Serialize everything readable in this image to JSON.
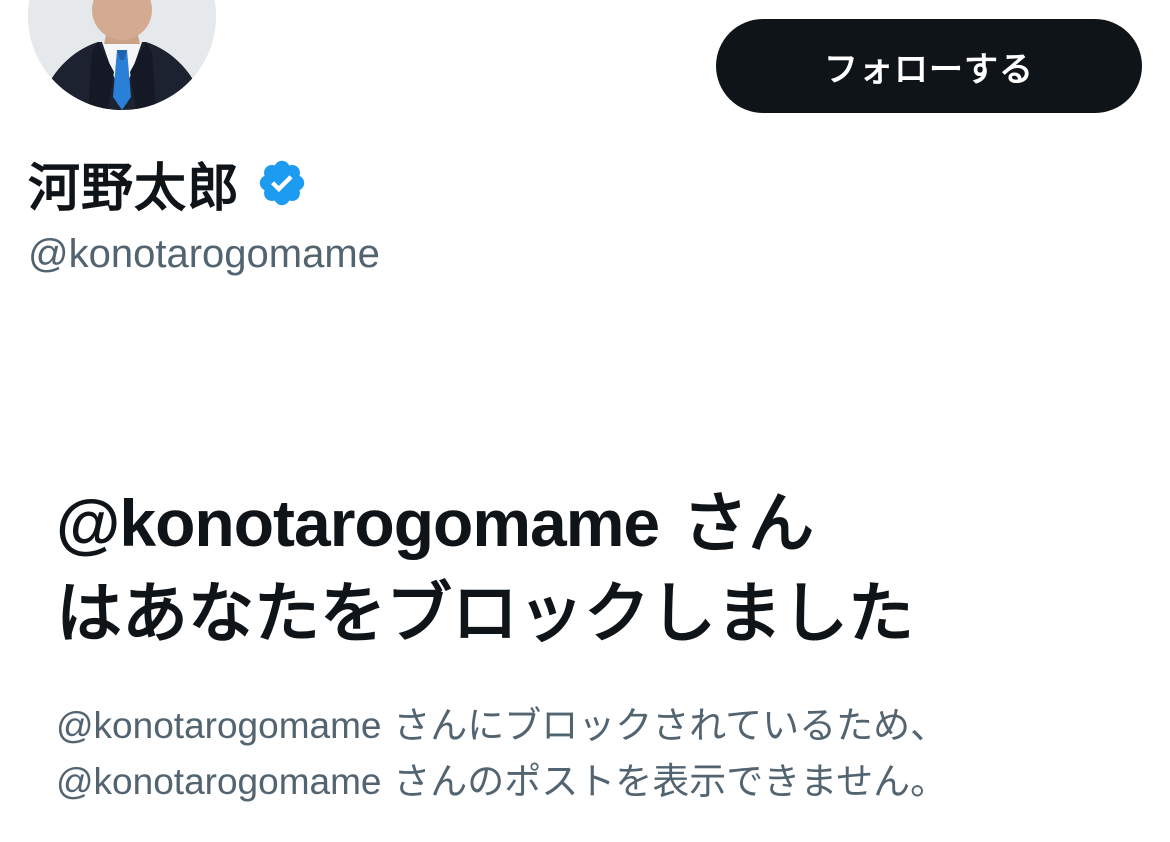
{
  "profile": {
    "display_name": "河野太郎",
    "handle": "@konotarogomame",
    "verified": true,
    "verified_color": "#1d9bf0"
  },
  "follow_button": {
    "label": "フォローする"
  },
  "blocked_notice": {
    "title_handle": "@konotarogomame",
    "title_suffix_line1": "さん",
    "title_line2": "はあなたをブロックしました",
    "desc_line1_handle": "@konotarogomame",
    "desc_line1_text": "さんにブロックされているため、",
    "desc_line2_handle": "@konotarogomame",
    "desc_line2_text": "さんのポストを表示できません。"
  },
  "colors": {
    "primary_text": "#0f1419",
    "secondary_text": "#536471",
    "button_bg": "#0f1419",
    "button_text": "#ffffff",
    "background": "#ffffff"
  }
}
